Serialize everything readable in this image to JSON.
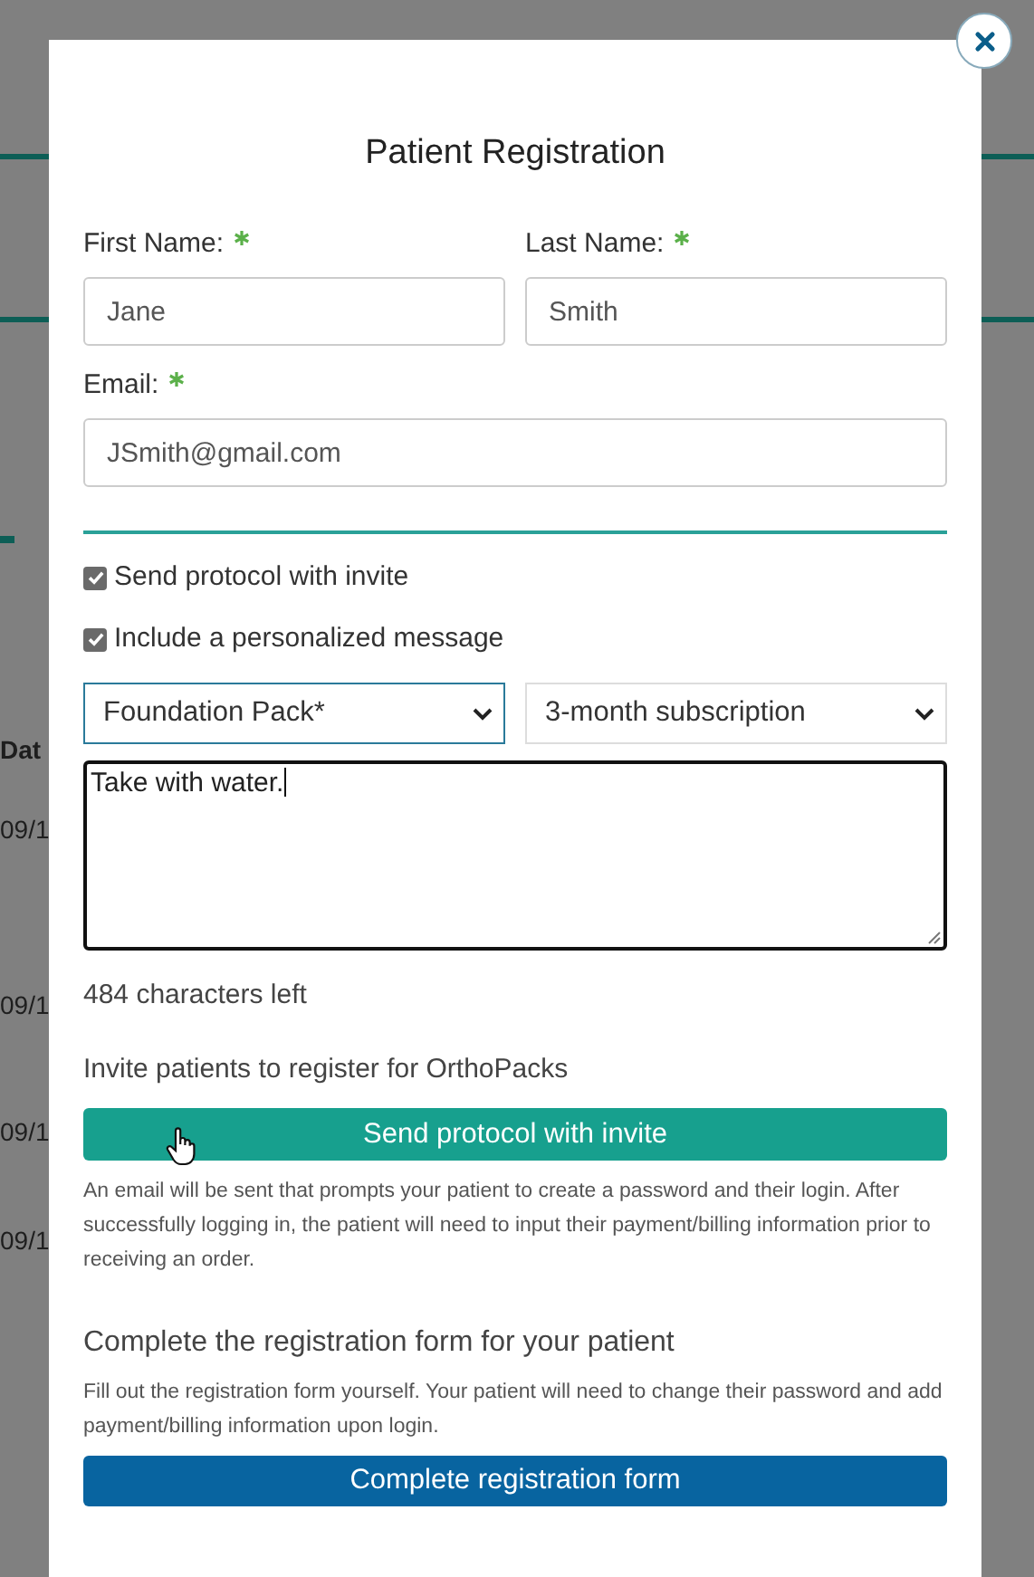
{
  "background": {
    "column_header": "Dat",
    "rows": [
      "09/1",
      "09/1",
      "09/1",
      "09/1"
    ]
  },
  "dialog": {
    "title": "Patient Registration",
    "fields": [
      {
        "label": "First Name:",
        "required": true,
        "value": "Jane"
      },
      {
        "label": "Last Name:",
        "required": true,
        "value": "Smith"
      },
      {
        "label": "Email:",
        "required": true,
        "value": "JSmith@gmail.com"
      }
    ],
    "options": [
      {
        "label": "Send protocol with invite",
        "checked": true
      },
      {
        "label": "Include a personalized message",
        "checked": true
      }
    ],
    "selects": [
      {
        "value": "Foundation Pack*",
        "focused": true
      },
      {
        "value": "3-month subscription",
        "focused": false
      }
    ],
    "message": {
      "value": "Take with water.",
      "counter": "484 characters left"
    },
    "invite": {
      "heading": "Invite patients to register for OrthoPacks",
      "button": "Send protocol with invite",
      "note": "An email will be sent that prompts your patient to create a password and their login. After successfully logging in, the patient will need to input their payment/billing information prior to receiving an order."
    },
    "complete": {
      "heading": "Complete the registration form for your patient",
      "note": "Fill out the registration form yourself. Your patient will need to change their password and add payment/billing information upon login.",
      "button": "Complete registration form"
    }
  }
}
